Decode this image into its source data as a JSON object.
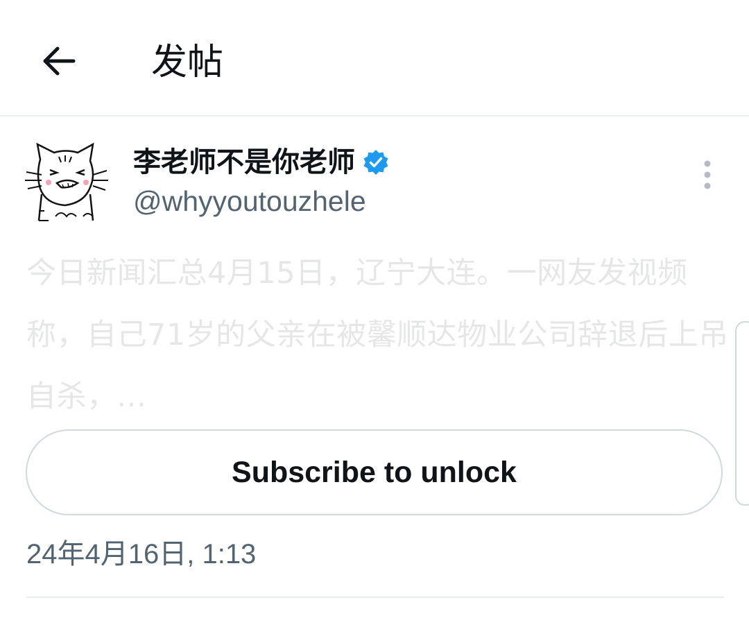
{
  "header": {
    "title": "发帖",
    "back_icon": "arrow-left-icon"
  },
  "post": {
    "author": {
      "display_name": "李老师不是你老师",
      "handle": "@whyyoutouzhele",
      "verified": true,
      "verified_color": "#1d9bf0"
    },
    "text": "今日新闻汇总4月15日，辽宁大连。一网友发视频称，自己71岁的父亲在被馨顺达物业公司辞退后上吊自杀，...",
    "subscribe_label": "Subscribe to unlock",
    "timestamp": "24年4月16日, 1:13"
  },
  "colors": {
    "text_primary": "#0f1419",
    "text_secondary": "#536471",
    "border": "#cfd9de",
    "verified": "#1d9bf0"
  }
}
